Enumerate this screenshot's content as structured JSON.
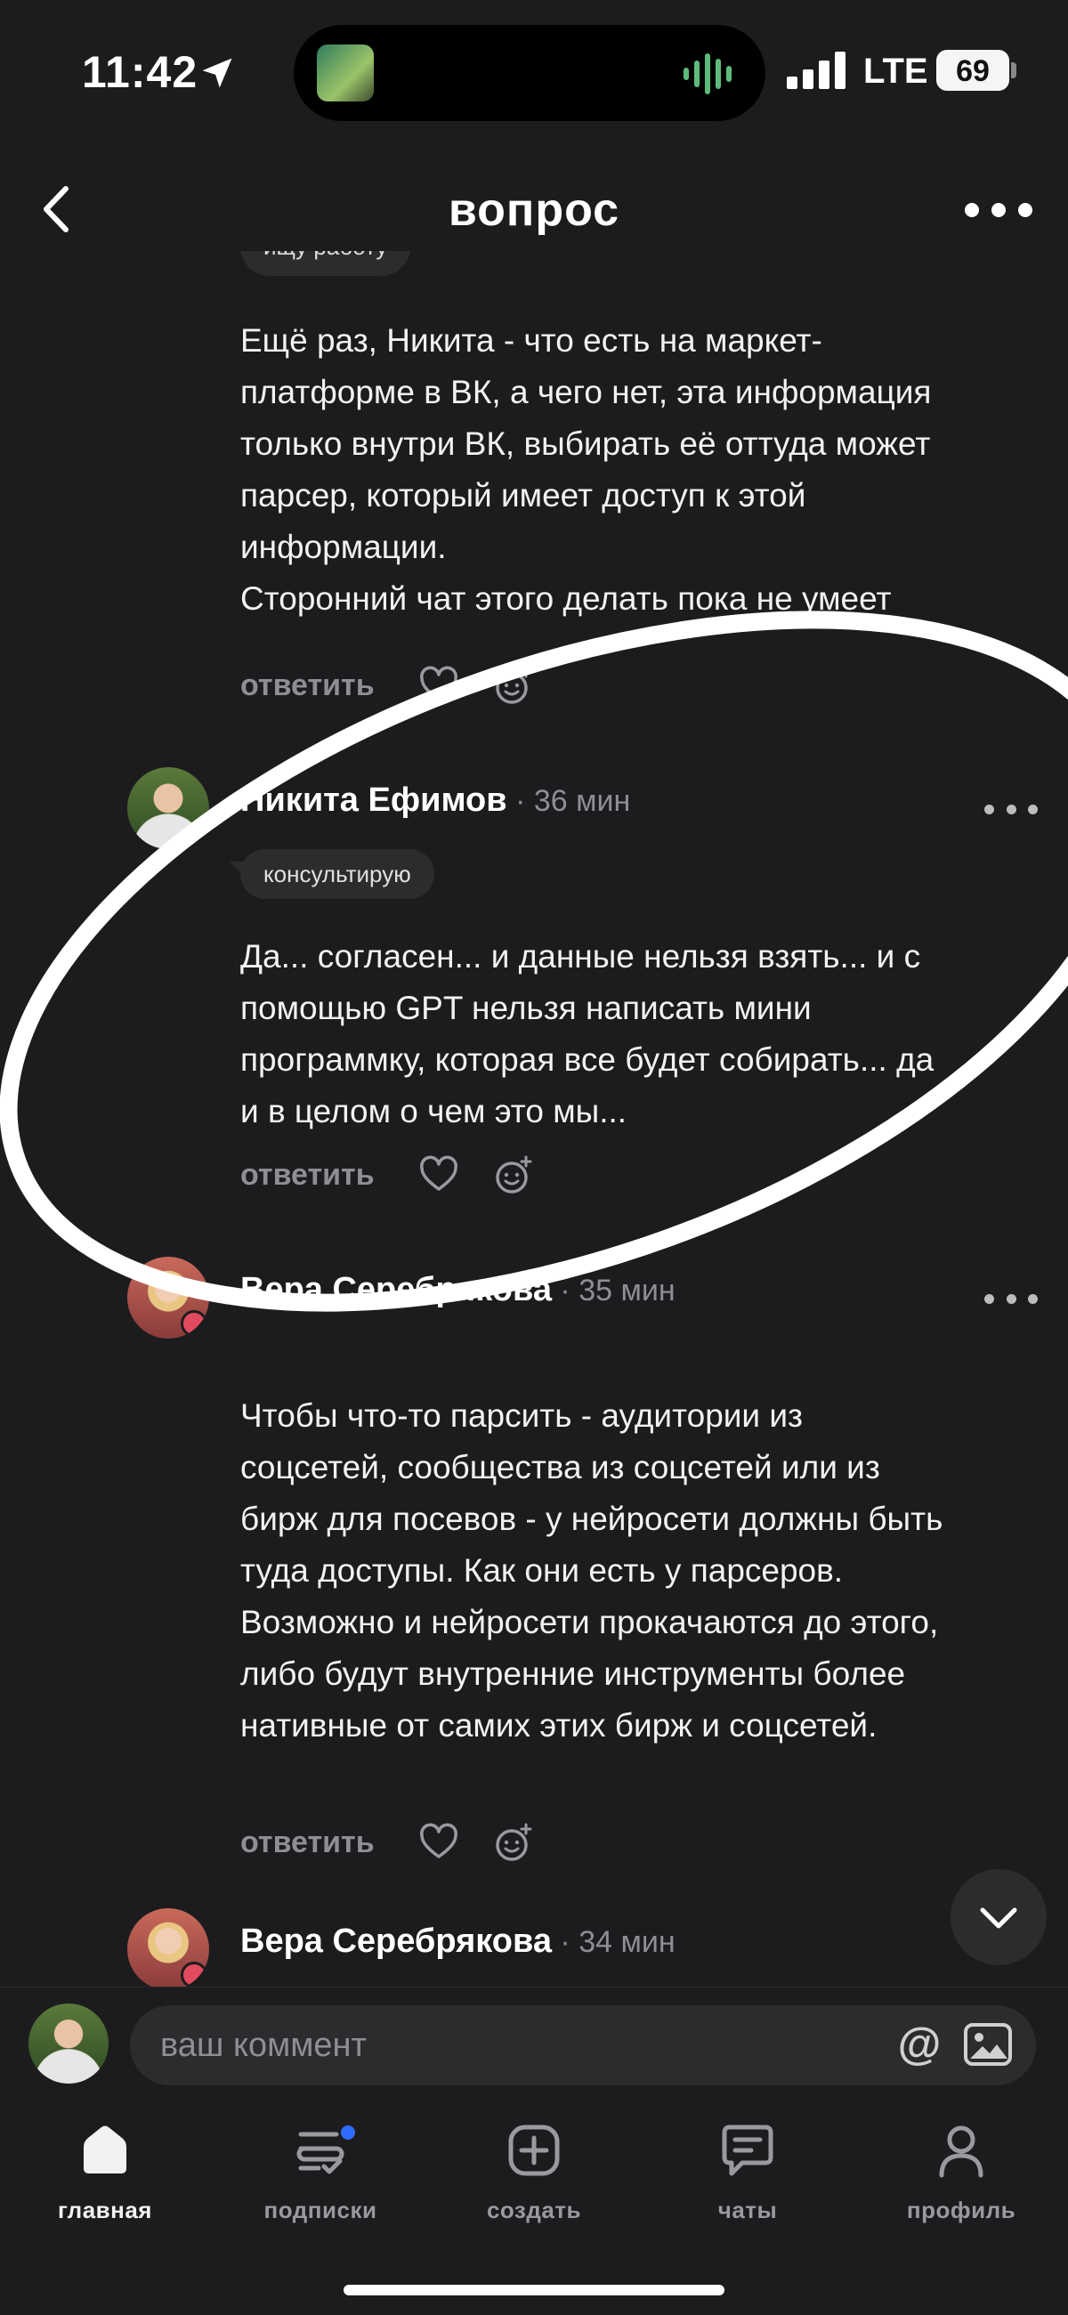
{
  "status_bar": {
    "time": "11:42",
    "network": "LTE",
    "battery": "69"
  },
  "header": {
    "title": "вопрос"
  },
  "feed": {
    "top_tag": "ищу работу",
    "comments": [
      {
        "author": "",
        "time_ago": "",
        "tag": "",
        "text": "Ещё раз, Никита - что есть на маркет-\nплатформе в ВК, а чего нет, эта информация\nтолько внутри ВК, выбирать её оттуда может\nпарсер, который имеет доступ к этой\nинформации.\nСторонний чат этого делать пока не умеет",
        "reply_label": "ответить"
      },
      {
        "author": "Никита Ефимов",
        "time_ago": " · 36 мин",
        "tag": "консультирую",
        "text": "Да... согласен... и данные нельзя взять... и с\nпомощью GPT нельзя написать мини\nпрограммку, которая все будет собирать... да\nи в целом о чем это мы...",
        "reply_label": "ответить"
      },
      {
        "author": "Вера Серебрякова",
        "time_ago": " · 35 мин",
        "tag": "",
        "text": "Чтобы что-то парсить - аудитории из\nсоцсетей, сообщества из соцсетей или из\nбирж для посевов - у нейросети должны быть\nтуда доступы. Как они есть у парсеров.\nВозможно и нейросети прокачаются до этого,\nлибо будут внутренние инструменты более\nнативные от самих этих бирж и соцсетей.",
        "reply_label": "ответить"
      },
      {
        "author": "Вера Серебрякова",
        "time_ago": " · 34 мин"
      }
    ]
  },
  "composer": {
    "placeholder": "ваш коммент",
    "mention_symbol": "@"
  },
  "tabbar": {
    "items": [
      {
        "label": "главная",
        "icon": "home-icon",
        "active": true
      },
      {
        "label": "подписки",
        "icon": "subscriptions-icon",
        "badge": true
      },
      {
        "label": "создать",
        "icon": "plus-square-icon"
      },
      {
        "label": "чаты",
        "icon": "chat-bubble-icon"
      },
      {
        "label": "профиль",
        "icon": "user-icon"
      }
    ]
  },
  "colors": {
    "background": "#1c1c1e",
    "chip": "#2c2c2e",
    "muted": "#8e8e93",
    "accent": "#2f6bff"
  }
}
